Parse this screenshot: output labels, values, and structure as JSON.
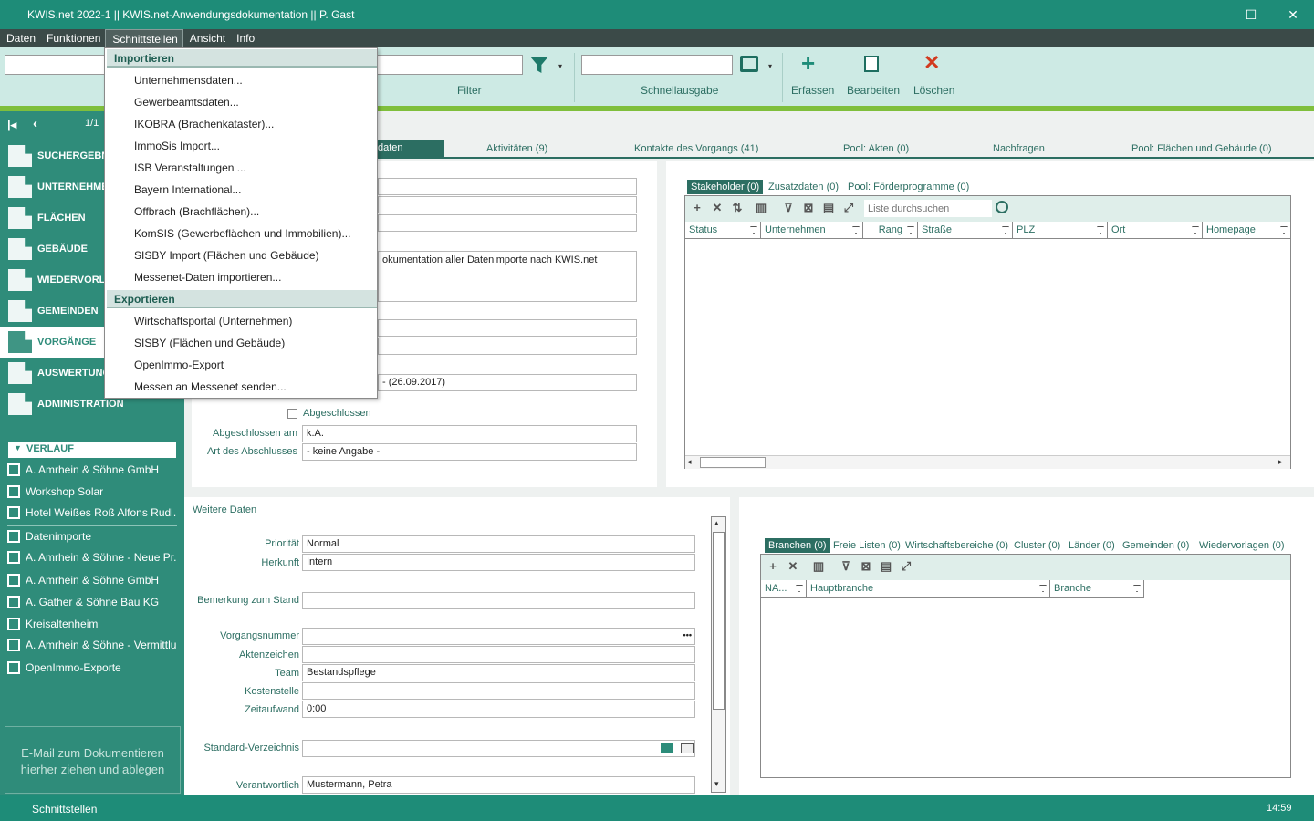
{
  "window": {
    "title": "KWIS.net 2022-1 || KWIS.net-Anwendungsdokumentation || P. Gast",
    "minimize": "—",
    "maximize": "☐",
    "close": "✕"
  },
  "menubar": [
    "Daten",
    "Funktionen",
    "Schnittstellen",
    "Ansicht",
    "Info"
  ],
  "toolbar": {
    "filter_label": "Filter",
    "schnellausgabe_label": "Schnellausgabe",
    "erfassen": "Erfassen",
    "bearbeiten": "Bearbeiten",
    "loeschen": "Löschen"
  },
  "pager": {
    "count": "1/1"
  },
  "sidebar": {
    "items": [
      "SUCHERGEBNI",
      "UNTERNEHME",
      "FLÄCHEN",
      "GEBÄUDE",
      "WIEDERVORLA",
      "GEMEINDEN",
      "VORGÄNGE",
      "AUSWERTUNG",
      "ADMINISTRATION"
    ],
    "verlauf_title": "VERLAUF",
    "verlauf_group1": [
      "A. Amrhein & Söhne GmbH",
      "Workshop Solar",
      "Hotel Weißes Roß Alfons Rudl..."
    ],
    "verlauf_group2": [
      "Datenimporte",
      "A. Amrhein & Söhne - Neue Pr...",
      "A. Amrhein & Söhne GmbH",
      "A. Gather & Söhne Bau KG",
      "Kreisaltenheim",
      "A. Amrhein & Söhne - Vermittlu...",
      "OpenImmo-Exporte"
    ],
    "dropzone": "E-Mail  zum Dokumentieren hierher ziehen und ablegen"
  },
  "main_tabs": {
    "active": "daten",
    "aktivitaeten": "Aktivitäten (9)",
    "kontakte": "Kontakte des Vorgangs (41)",
    "pool_akten": "Pool: Akten (0)",
    "nachfragen": "Nachfragen",
    "pool_flaechen": "Pool: Flächen und Gebäude (0)"
  },
  "form_top": {
    "description": "okumentation aller Datenimporte nach KWIS.net",
    "period": "- (26.09.2017)",
    "abgeschlossen_label": "Abgeschlossen",
    "abgeschlossen_am_label": "Abgeschlossen am",
    "abgeschlossen_am_value": "k.A.",
    "art_label": "Art des Abschlusses",
    "art_value": "- keine Angabe -"
  },
  "stakeholder": {
    "tabs": [
      "Stakeholder (0)",
      "Zusatzdaten (0)",
      "Pool: Förderprogramme (0)"
    ],
    "search_placeholder": "Liste durchsuchen",
    "columns": [
      "Status",
      "Unternehmen",
      "Rang",
      "Straße",
      "PLZ",
      "Ort",
      "Homepage"
    ]
  },
  "weitere": {
    "link": "Weitere Daten",
    "prioritaet_label": "Priorität",
    "prioritaet_value": "Normal",
    "herkunft_label": "Herkunft",
    "herkunft_value": "Intern",
    "bemerkung_label": "Bemerkung zum Stand",
    "vorgangsnummer_label": "Vorgangsnummer",
    "vorgangsnummer_btn": "•••",
    "aktenzeichen_label": "Aktenzeichen",
    "team_label": "Team",
    "team_value": "Bestandspflege",
    "kostenstelle_label": "Kostenstelle",
    "zeitaufwand_label": "Zeitaufwand",
    "zeitaufwand_value": "0:00",
    "verzeichnis_label": "Standard-Verzeichnis",
    "verantwortlich_label": "Verantwortlich",
    "verantwortlich_value": "Mustermann, Petra"
  },
  "branchen": {
    "tabs": [
      "Branchen (0)",
      "Freie Listen (0)",
      "Wirtschaftsbereiche (0)",
      "Cluster (0)",
      "Länder (0)",
      "Gemeinden (0)",
      "Wiedervorlagen (0)"
    ],
    "columns": [
      "NA...",
      "Hauptbranche",
      "Branche"
    ]
  },
  "dropdown": {
    "import_header": "Importieren",
    "import_items": [
      "Unternehmensdaten...",
      "Gewerbeamtsdaten...",
      "IKOBRA (Brachenkataster)...",
      "ImmoSis Import...",
      "ISB Veranstaltungen ...",
      "Bayern International...",
      "Offbrach (Brachflächen)...",
      "KomSIS (Gewerbeflächen und Immobilien)...",
      "SISBY Import (Flächen und Gebäude)",
      "Messenet-Daten importieren..."
    ],
    "export_header": "Exportieren",
    "export_items": [
      "Wirtschaftsportal (Unternehmen)",
      "SISBY (Flächen und Gebäude)",
      "OpenImmo-Export",
      "Messen an Messenet senden..."
    ]
  },
  "statusbar": {
    "left": "Schnittstellen",
    "time": "14:59"
  }
}
